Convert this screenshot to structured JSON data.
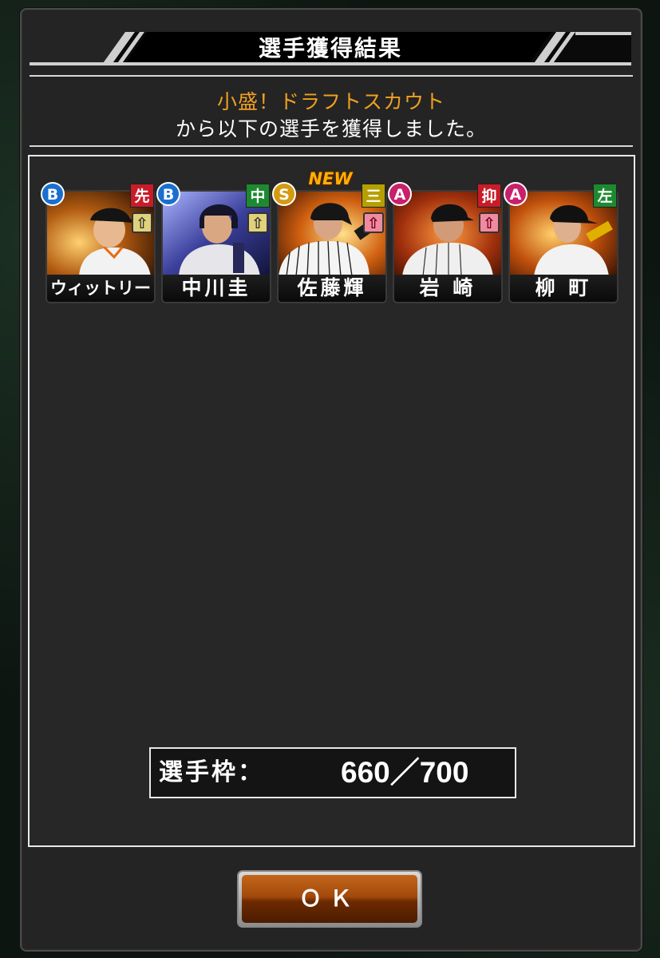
{
  "dialog": {
    "title": "選手獲得結果",
    "scout_name": "小盛！ドラフトスカウト",
    "message": "から以下の選手を獲得しました。"
  },
  "players": [
    {
      "name": "ウィットリー",
      "rank": "B",
      "position": "先",
      "trend": "up",
      "new": false
    },
    {
      "name": "中川圭",
      "rank": "B",
      "position": "中",
      "trend": "up",
      "new": false
    },
    {
      "name": "佐藤輝",
      "rank": "S",
      "position": "三",
      "trend": "up",
      "new": true
    },
    {
      "name": "岩 崎",
      "rank": "A",
      "position": "抑",
      "trend": "up",
      "new": false
    },
    {
      "name": "柳 町",
      "rank": "A",
      "position": "左",
      "trend": "none",
      "new": false
    }
  ],
  "new_tag": "NEW",
  "roster": {
    "label": "選手枠：",
    "value": "660／700"
  },
  "ok_button": "ＯＫ",
  "colors": {
    "scout_name": "#f0a020",
    "rank_B": "#1a6fd0",
    "rank_S": "#d49a10",
    "rank_A": "#c8206a",
    "pos_pitcher": "#c81c28",
    "pos_fielder": "#1c8a30",
    "pos_third": "#b6a000",
    "button": "#a24a0c"
  }
}
